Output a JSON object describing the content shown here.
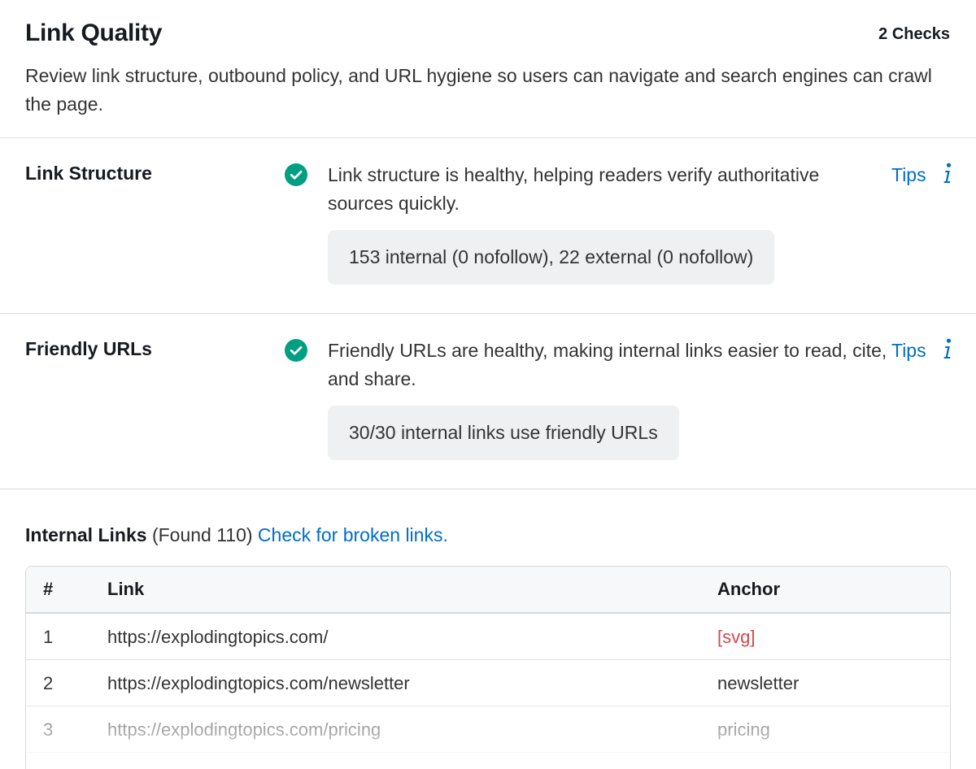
{
  "header": {
    "title": "Link Quality",
    "checks": "2 Checks",
    "description": "Review link structure, outbound policy, and URL hygiene so users can navigate and search engines can crawl the page."
  },
  "checks": [
    {
      "label": "Link Structure",
      "status": "pass",
      "message": "Link structure is healthy, helping readers verify authoritative sources quickly.",
      "tips_label": "Tips",
      "detail": "153 internal (0 nofollow), 22 external (0 nofollow)"
    },
    {
      "label": "Friendly URLs",
      "status": "pass",
      "message": "Friendly URLs are healthy, making internal links easier to read, cite, and share.",
      "tips_label": "Tips",
      "detail": "30/30 internal links use friendly URLs"
    }
  ],
  "internal_links": {
    "heading": "Internal Links",
    "found": "(Found 110)",
    "broken_link_label": "Check for broken links.",
    "columns": [
      "#",
      "Link",
      "Anchor"
    ],
    "rows": [
      {
        "num": "1",
        "link": "https://explodingtopics.com/",
        "anchor": "[svg]"
      },
      {
        "num": "2",
        "link": "https://explodingtopics.com/newsletter",
        "anchor": "newsletter"
      },
      {
        "num": "3",
        "link": "https://explodingtopics.com/pricing",
        "anchor": "pricing"
      }
    ]
  },
  "colors": {
    "success": "#009f81",
    "link": "#006dca",
    "anchor_red": "#d1484d"
  },
  "icons": {
    "status": "check-circle-icon",
    "info": "info-icon"
  }
}
